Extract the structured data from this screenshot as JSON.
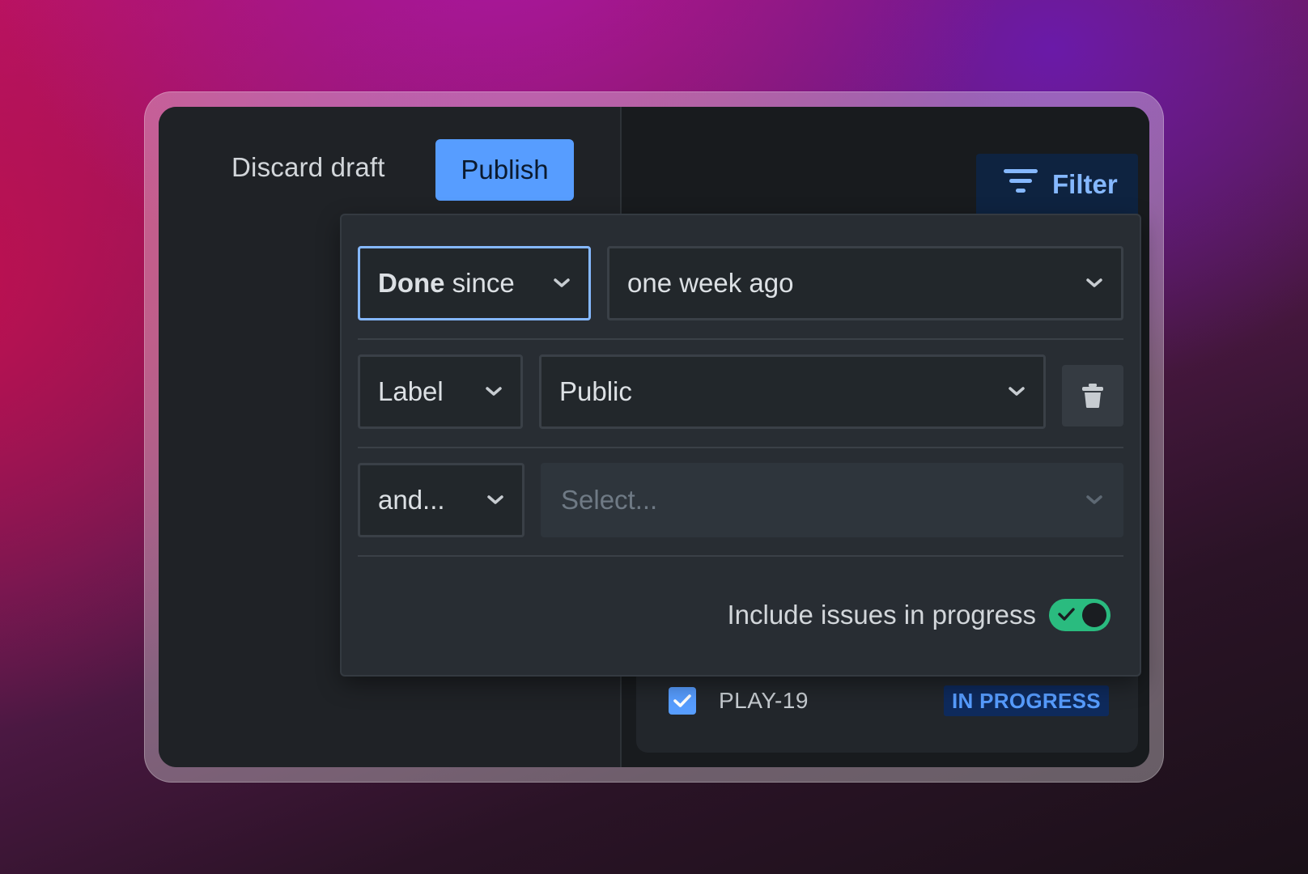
{
  "toolbar": {
    "discard_label": "Discard draft",
    "publish_label": "Publish",
    "filter_label": "Filter"
  },
  "filter_panel": {
    "row1": {
      "field_bold": "Done",
      "field_rest": " since",
      "value": "one week ago"
    },
    "row2": {
      "field": "Label",
      "value": "Public"
    },
    "row3": {
      "field": "and...",
      "placeholder": "Select..."
    },
    "toggle": {
      "label": "Include issues in progress",
      "on": true
    }
  },
  "issue": {
    "key": "PLAY-19",
    "checked": true,
    "status": "IN PROGRESS"
  },
  "icons": [
    "filter-icon",
    "chevron-down-icon",
    "trash-icon",
    "check-icon"
  ],
  "colors": {
    "accent": "#579dff",
    "toggle_on": "#2abb7f",
    "status_text": "#579dff"
  }
}
